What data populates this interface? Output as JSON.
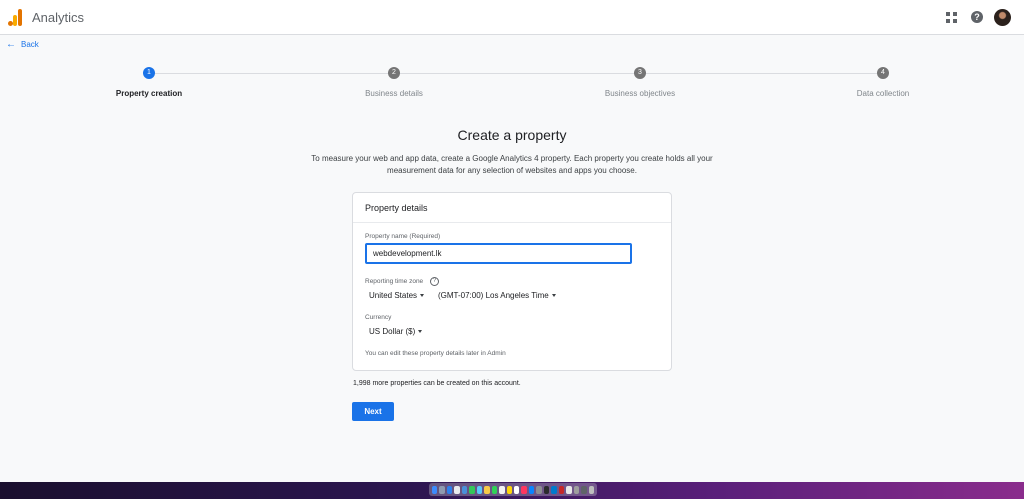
{
  "app": {
    "title": "Analytics"
  },
  "nav": {
    "back_label": "Back"
  },
  "stepper": {
    "steps": [
      {
        "number": "1",
        "label": "Property creation",
        "active": true
      },
      {
        "number": "2",
        "label": "Business details",
        "active": false
      },
      {
        "number": "3",
        "label": "Business objectives",
        "active": false
      },
      {
        "number": "4",
        "label": "Data collection",
        "active": false
      }
    ]
  },
  "page": {
    "title": "Create a property",
    "intro": "To measure your web and app data, create a Google Analytics 4 property. Each property you create holds all your measurement data for any selection of websites and apps you choose."
  },
  "card": {
    "title": "Property details",
    "property_name_label": "Property name (Required)",
    "property_name_value": "webdevelopment.lk",
    "timezone_label": "Reporting time zone",
    "country_value": "United States",
    "timezone_value": "(GMT-07:00) Los Angeles Time",
    "currency_label": "Currency",
    "currency_value": "US Dollar ($)",
    "hint": "You can edit these property details later in Admin"
  },
  "quota_text": "1,998 more properties can be created on this account.",
  "next_label": "Next",
  "icons": {
    "help": "?",
    "back_arrow": "←"
  },
  "colors": {
    "accent": "#1a73e8",
    "step_inactive": "#757575",
    "logo_orange": "#e37400",
    "logo_yellow": "#f9ab00"
  },
  "dock_apps": [
    "finder",
    "launchpad",
    "safari",
    "chrome",
    "mail",
    "messages",
    "maps",
    "photos",
    "facetime",
    "calendar",
    "notes",
    "reminders",
    "music",
    "app-store",
    "settings",
    "terminal",
    "vscode",
    "filezilla",
    "slack",
    "preview",
    "calculator",
    "trash"
  ]
}
